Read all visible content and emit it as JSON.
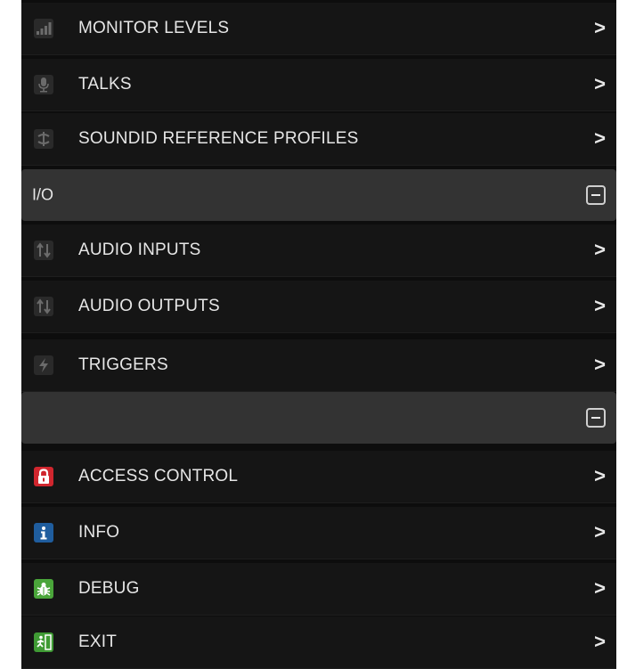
{
  "menu": {
    "top_items": [
      {
        "label": "MONITOR LEVELS",
        "icon": "signal-bars-icon"
      },
      {
        "label": "TALKS",
        "icon": "microphone-icon"
      },
      {
        "label": "SOUNDID REFERENCE PROFILES",
        "icon": "soundid-icon"
      }
    ],
    "io_section": {
      "title": "I/O",
      "items": [
        {
          "label": "AUDIO INPUTS",
          "icon": "arrows-updown-icon"
        },
        {
          "label": "AUDIO OUTPUTS",
          "icon": "arrows-updown-icon"
        },
        {
          "label": "TRIGGERS",
          "icon": "lightning-icon"
        }
      ]
    },
    "second_section": {
      "title": "",
      "items": [
        {
          "label": "ACCESS CONTROL",
          "icon": "lock-icon",
          "color": "#d0262e"
        },
        {
          "label": "INFO",
          "icon": "info-icon",
          "color": "#1f5d9e"
        },
        {
          "label": "DEBUG",
          "icon": "bug-icon",
          "color": "#4aa53a"
        },
        {
          "label": "EXIT",
          "icon": "exit-icon",
          "color": "#3f9a34"
        }
      ]
    },
    "chevron": ">"
  }
}
